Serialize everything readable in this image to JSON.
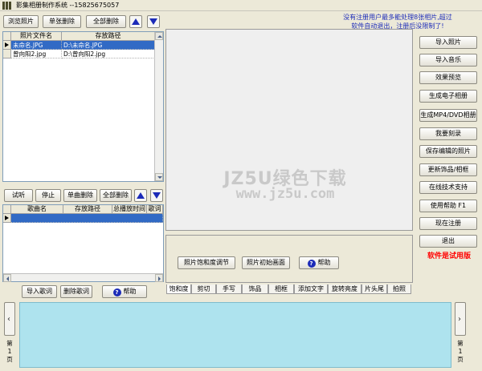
{
  "window": {
    "title": "影集相册制作系统 --15825675057",
    "notice_line1": "没有注册用户最多能处理8张相片,超过",
    "notice_line2": "软件自动退出，注册后没限制了!"
  },
  "photo_toolbar": {
    "browse": "浏览照片",
    "delete_one": "单张删除",
    "delete_all": "全部删除"
  },
  "photo_table": {
    "columns": [
      "照片文件名",
      "存放路径"
    ],
    "rows": [
      {
        "name": "未命名.JPG",
        "path": "D:\\未命名.JPG"
      },
      {
        "name": "曾向阳2.jpg",
        "path": "D:\\曾向阳2.jpg"
      }
    ]
  },
  "music_toolbar": {
    "listen": "试听",
    "stop": "停止",
    "delete_one": "单曲删除",
    "delete_all": "全部删除"
  },
  "music_table": {
    "columns": [
      "歌曲名",
      "存放路径",
      "总播放时间",
      "歌词"
    ]
  },
  "lyrics_toolbar": {
    "import": "导入歌词",
    "delete": "删除歌词",
    "help": "帮助"
  },
  "preview": {
    "watermark": "JZ5U绿色下载",
    "watermark_url": "www.jz5u.com"
  },
  "tool_panel": {
    "saturation": "照片饱和度调节",
    "init": "照片初始画面",
    "help": "帮助"
  },
  "tabs": [
    "饱和度",
    "剪切",
    "手写",
    "饰品",
    "相框",
    "添加文字",
    "旋转亮度",
    "片头尾",
    "拍照"
  ],
  "right_buttons": [
    "导入照片",
    "导入音乐",
    "效果预览",
    "生成电子相册",
    "生成MP4/DVD相册",
    "我要刻录",
    "保存编辑的照片",
    "更新饰品/相框",
    "在线技术支持",
    "使用帮助  F1",
    "现在注册",
    "退出"
  ],
  "trial_label": "软件是试用版",
  "page": {
    "left": [
      "第",
      "1",
      "页"
    ],
    "right": [
      "第",
      "1",
      "页"
    ]
  },
  "colors": {
    "accent_blue": "#1c2bb8",
    "selection": "#316ac5",
    "strip": "#aee3ee",
    "trial_red": "#ff0000"
  }
}
